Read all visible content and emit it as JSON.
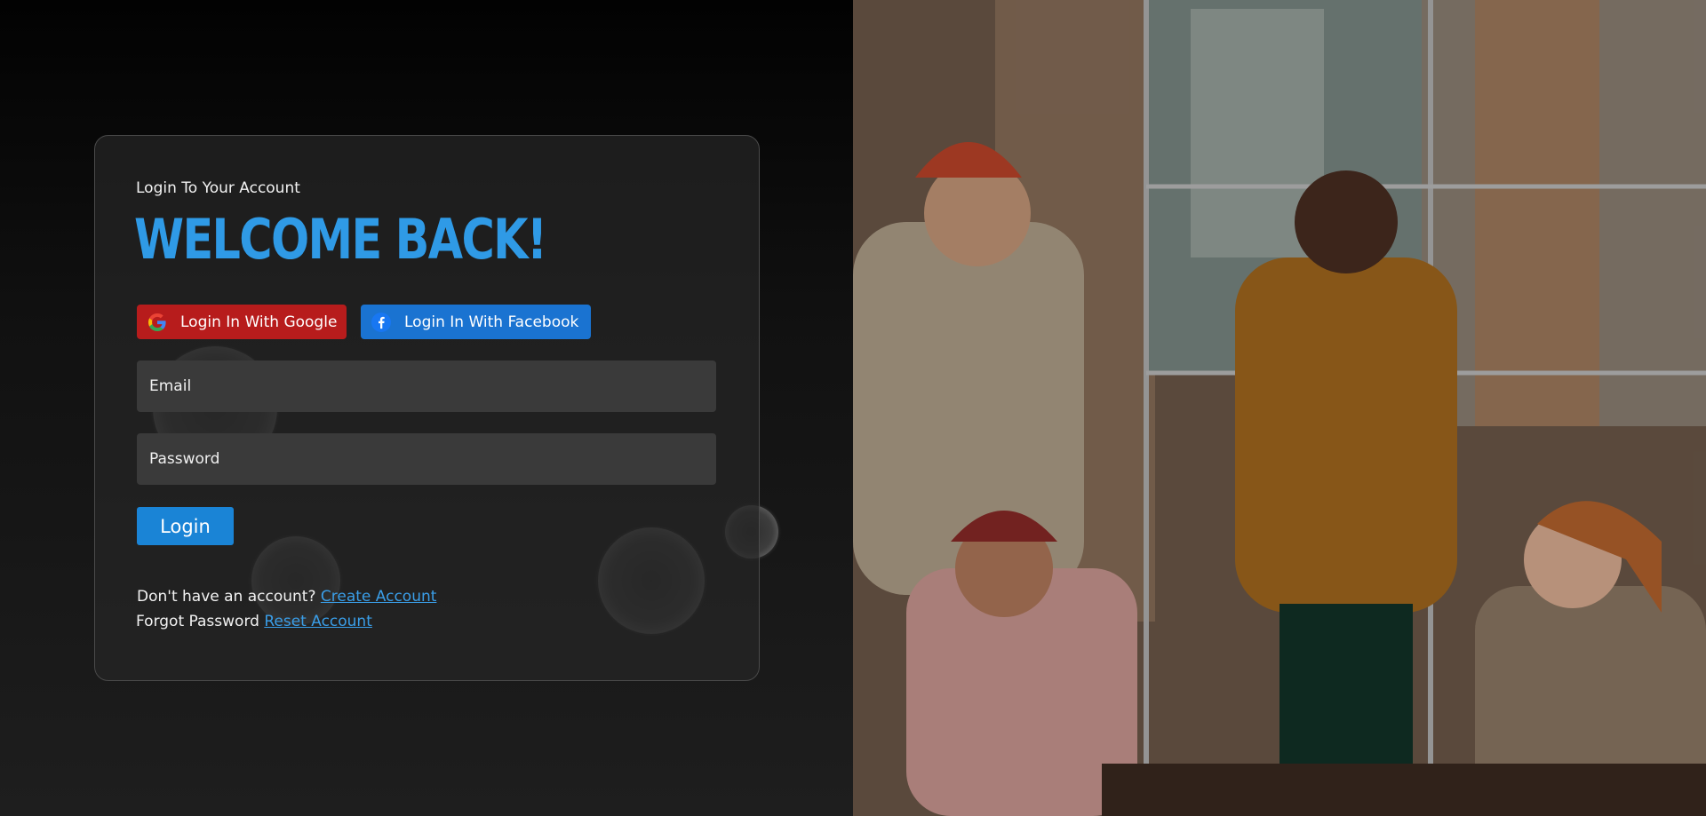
{
  "login": {
    "subtitle": "Login To Your Account",
    "headline": "WELCOME BACK!",
    "google_label": "Login In With Google",
    "facebook_label": "Login In With Facebook",
    "email_placeholder": "Email",
    "password_placeholder": "Password",
    "login_label": "Login",
    "signup_prompt": "Don't have an account?",
    "signup_link": "Create Account",
    "forgot_prompt": "Forgot Password",
    "forgot_link": "Reset Account"
  },
  "icons": {
    "google": "google-icon",
    "facebook": "facebook-icon"
  },
  "colors": {
    "accent": "#2f9ae6",
    "google_button": "#b71c1c",
    "facebook_button": "#1a73d1",
    "login_button": "#1a84d6",
    "field_bg": "#3a3a3a",
    "link": "#3a9ee8"
  },
  "hero_image": {
    "description": "Group of friends celebrating around a table with pizza in a brick loft office"
  }
}
